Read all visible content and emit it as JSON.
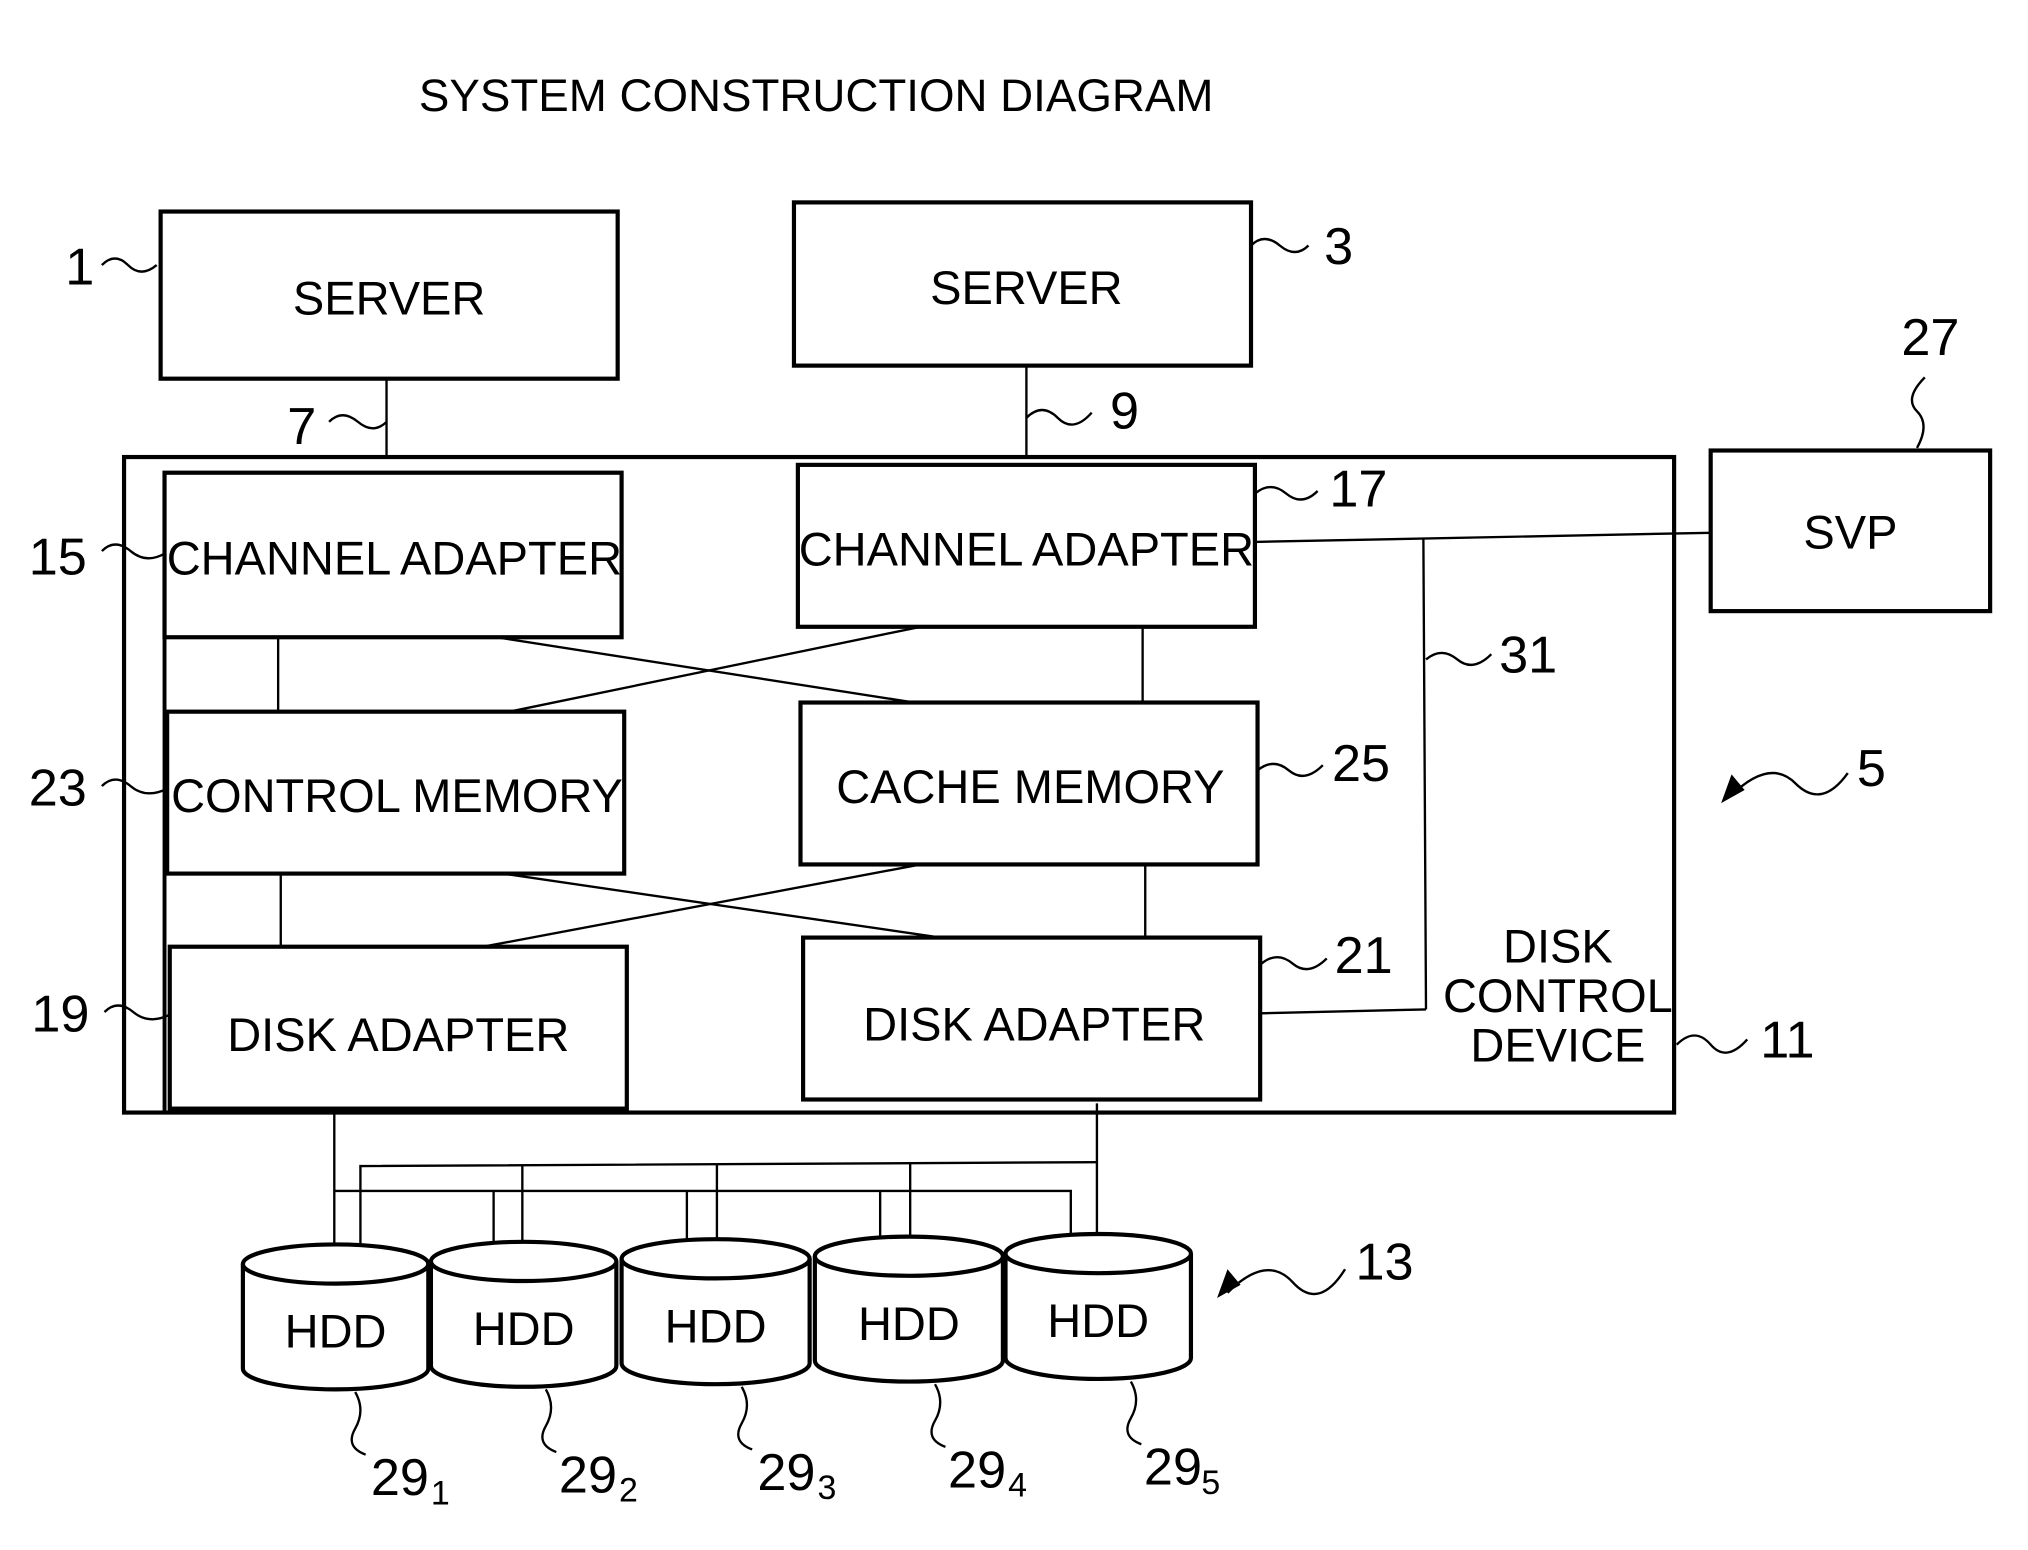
{
  "title": "SYSTEM CONSTRUCTION DIAGRAM",
  "nodes": {
    "server1": {
      "label": "SERVER",
      "ref": "1"
    },
    "server3": {
      "label": "SERVER",
      "ref": "3"
    },
    "svp": {
      "label": "SVP",
      "ref": "27"
    },
    "channel_adapter_15": {
      "label": "CHANNEL ADAPTER",
      "ref": "15"
    },
    "channel_adapter_17": {
      "label": "CHANNEL ADAPTER",
      "ref": "17"
    },
    "control_memory": {
      "label": "CONTROL MEMORY",
      "ref": "23"
    },
    "cache_memory": {
      "label": "CACHE MEMORY",
      "ref": "25"
    },
    "disk_adapter_19": {
      "label": "DISK ADAPTER",
      "ref": "19"
    },
    "disk_adapter_21": {
      "label": "DISK ADAPTER",
      "ref": "21"
    },
    "disk_control_device": {
      "label_lines": [
        "DISK",
        "CONTROL",
        "DEVICE"
      ],
      "ref": "11"
    }
  },
  "links": {
    "link7": "7",
    "link9": "9",
    "link31": "31"
  },
  "groups": {
    "storage_system": "5",
    "hdd_group": "13"
  },
  "hdds": [
    {
      "label": "HDD",
      "ref": "29",
      "sub": "1"
    },
    {
      "label": "HDD",
      "ref": "29",
      "sub": "2"
    },
    {
      "label": "HDD",
      "ref": "29",
      "sub": "3"
    },
    {
      "label": "HDD",
      "ref": "29",
      "sub": "4"
    },
    {
      "label": "HDD",
      "ref": "29",
      "sub": "5"
    }
  ]
}
